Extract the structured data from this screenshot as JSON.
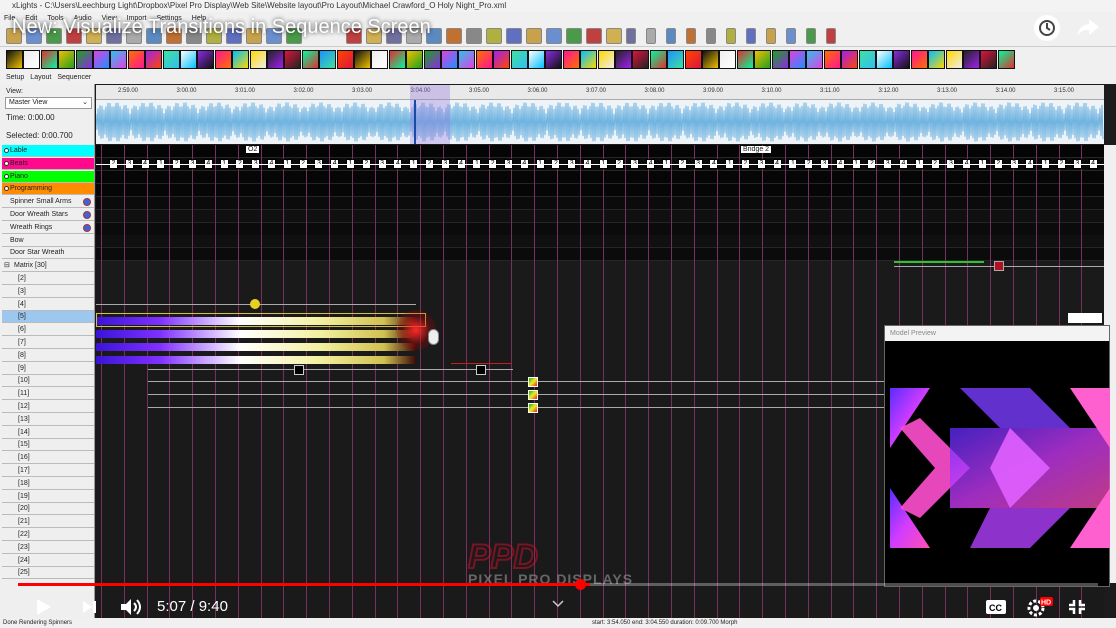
{
  "app": {
    "title": "xLights - C:\\Users\\Leechburg Light\\Dropbox\\Pixel Pro Display\\Web Site\\Website layout\\Pro Layout\\Michael Crawford_O Holy Night_Pro.xml"
  },
  "menu": [
    "File",
    "Edit",
    "Tools",
    "Audio",
    "View",
    "Import",
    "Settings",
    "Help"
  ],
  "tabs": [
    "Setup",
    "Layout",
    "Sequencer"
  ],
  "left": {
    "view_label": "View:",
    "view_value": "Master View",
    "time": "Time: 0:00.00",
    "selected": "Selected: 0:00.700",
    "rows": [
      {
        "label": "Lable",
        "color": "#00ffff"
      },
      {
        "label": "Beats",
        "color": "#ff0a8c"
      },
      {
        "label": "Piano",
        "color": "#00ff00"
      },
      {
        "label": "Programming",
        "color": "#ff8c00"
      },
      {
        "label": "Spinner Small Arms",
        "color": ""
      },
      {
        "label": "Door Wreath Stars",
        "color": ""
      },
      {
        "label": "Wreath Rings",
        "color": ""
      },
      {
        "label": "Bow",
        "color": ""
      },
      {
        "label": "Door Star Wreath",
        "color": ""
      },
      {
        "label": "Matrix [30]",
        "color": ""
      },
      {
        "label": "[2]",
        "color": ""
      },
      {
        "label": "[3]",
        "color": ""
      },
      {
        "label": "[4]",
        "color": ""
      },
      {
        "label": "[5]",
        "color": "#9cc8f0"
      },
      {
        "label": "[6]",
        "color": ""
      },
      {
        "label": "[7]",
        "color": ""
      },
      {
        "label": "[8]",
        "color": ""
      },
      {
        "label": "[9]",
        "color": ""
      },
      {
        "label": "[10]",
        "color": ""
      },
      {
        "label": "[11]",
        "color": ""
      },
      {
        "label": "[12]",
        "color": ""
      },
      {
        "label": "[13]",
        "color": ""
      },
      {
        "label": "[14]",
        "color": ""
      },
      {
        "label": "[15]",
        "color": ""
      },
      {
        "label": "[16]",
        "color": ""
      },
      {
        "label": "[17]",
        "color": ""
      },
      {
        "label": "[18]",
        "color": ""
      },
      {
        "label": "[19]",
        "color": ""
      },
      {
        "label": "[20]",
        "color": ""
      },
      {
        "label": "[21]",
        "color": ""
      },
      {
        "label": "[22]",
        "color": ""
      },
      {
        "label": "[23]",
        "color": ""
      },
      {
        "label": "[24]",
        "color": ""
      },
      {
        "label": "[25]",
        "color": ""
      }
    ]
  },
  "ruler": {
    "ticks": [
      "2:59.00",
      "3:00.00",
      "3:01.00",
      "3:02.00",
      "3:03.00",
      "3:04.00",
      "3:05.00",
      "3:06.00",
      "3:07.00",
      "3:08.00",
      "3:09.00",
      "3:10.00",
      "3:11.00",
      "3:12.00",
      "3:13.00",
      "3:14.00",
      "3:15.00"
    ]
  },
  "timing": {
    "label1": "O2",
    "label2": "Bridge 2",
    "beats": [
      "2",
      "3",
      "4",
      "1",
      "2",
      "3",
      "4",
      "1",
      "2",
      "3",
      "4",
      "1",
      "2",
      "3",
      "4",
      "1",
      "2",
      "3",
      "4",
      "1",
      "2",
      "3",
      "4",
      "1",
      "2",
      "3",
      "4",
      "1",
      "2",
      "3",
      "4",
      "1",
      "2",
      "3",
      "4",
      "1",
      "2",
      "3",
      "4",
      "1",
      "2",
      "3",
      "4",
      "1",
      "2",
      "3",
      "4",
      "1",
      "2",
      "3",
      "4",
      "1",
      "2",
      "3",
      "4",
      "1",
      "2",
      "3",
      "4",
      "1",
      "2",
      "3",
      "4"
    ]
  },
  "preview": {
    "title": "Model Preview"
  },
  "video": {
    "title": "New: Visualize Transitions in Sequence Screen",
    "current": "5:07",
    "duration": "9:40",
    "progress": 0.53,
    "accent": "#ff0000"
  },
  "status": {
    "left": "Done Rendering Spinners",
    "right": "start: 3:54.050 end: 3:04.550 duration: 0:09.700 Morph"
  },
  "watermark": {
    "line1": "PPD",
    "line2": "PIXEL PRO DISPLAYS"
  }
}
